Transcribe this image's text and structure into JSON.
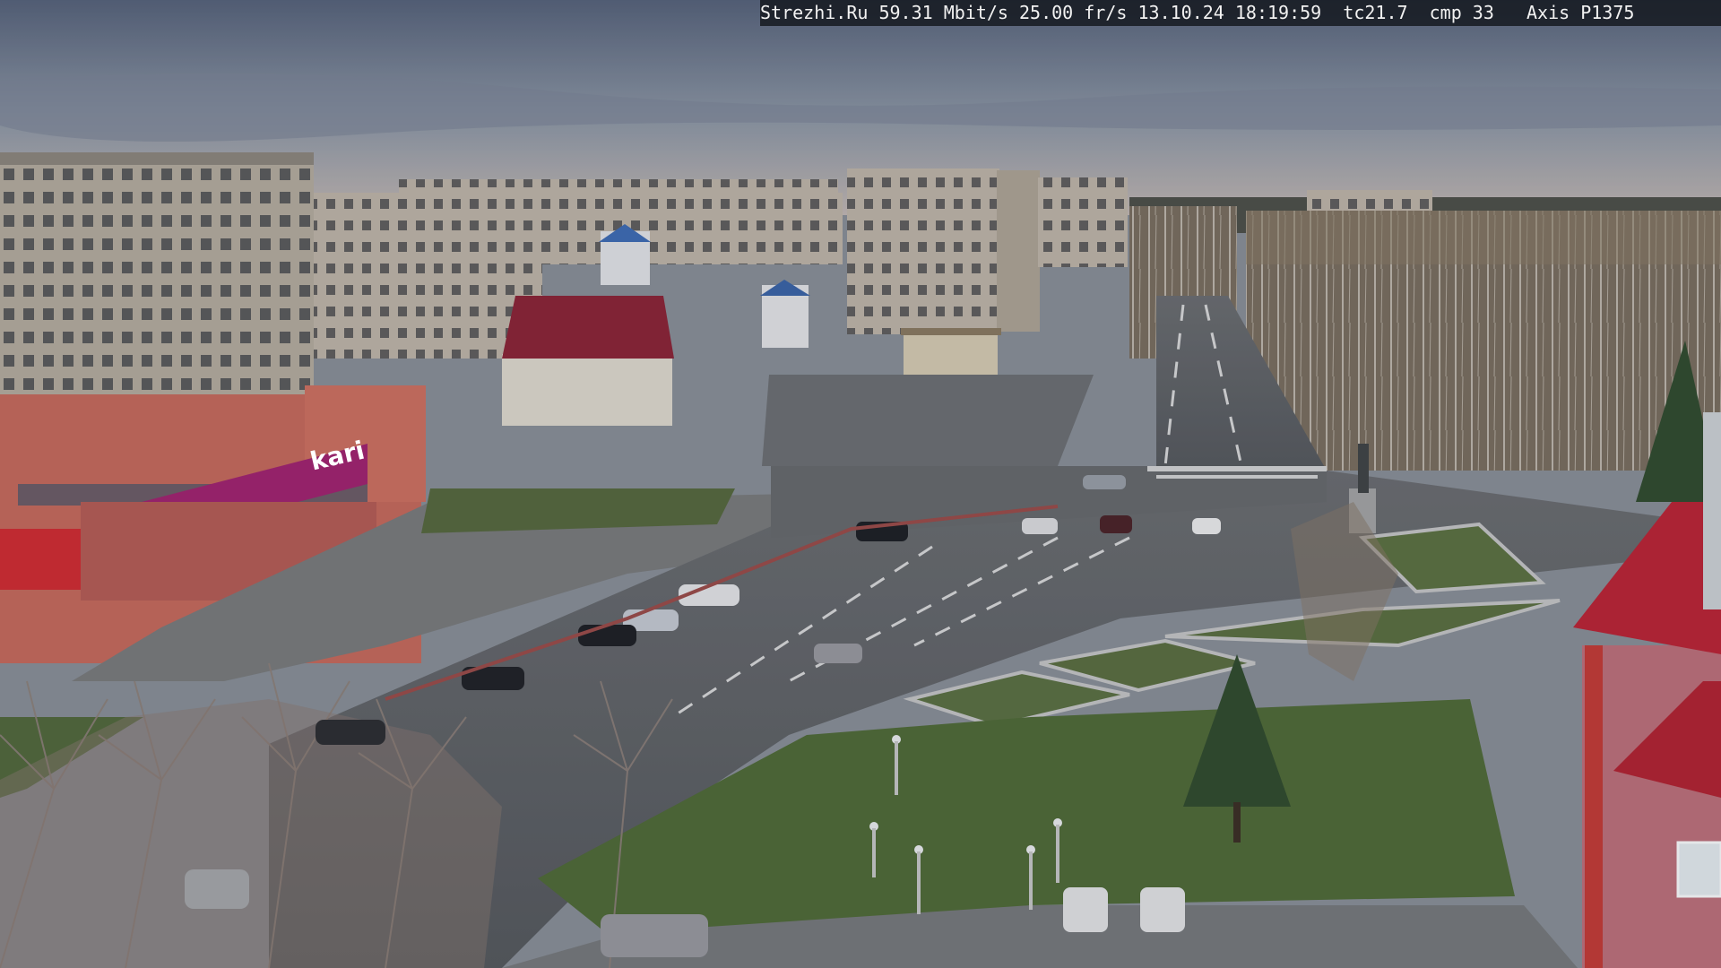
{
  "camera_overlay": {
    "site": "Strezhi.Ru",
    "bitrate": "59.31 Mbit/s",
    "framerate": "25.00 fr/s",
    "date": "13.10.24",
    "time": "18:19:59",
    "tc": "tc21.7",
    "cmp": "cmp 33",
    "camera_model": "Axis P1375"
  },
  "signage": {
    "store_logo": "kari"
  },
  "colors": {
    "sky_top": "#5e6a7c",
    "sky_bottom": "#a8b0ba",
    "asphalt": "#5c5f63",
    "grass": "#4f6a35",
    "store_magenta": "#a3206f",
    "building_red": "#c6463a",
    "panel_building": "#b4aa9c"
  }
}
